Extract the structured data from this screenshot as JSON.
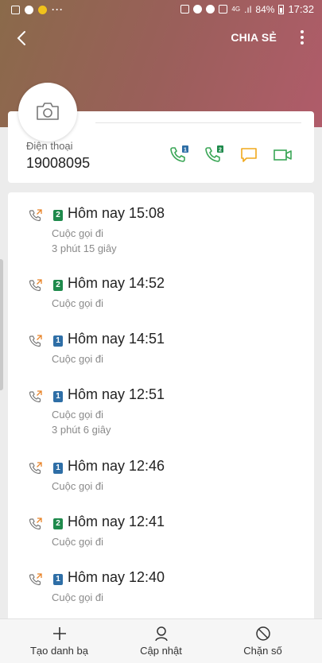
{
  "status_bar": {
    "battery": "84%",
    "time": "17:32",
    "network": "4G"
  },
  "toolbar": {
    "share_label": "CHIA SẺ"
  },
  "contact": {
    "phone_label": "Điện thoại",
    "phone_number": "19008095",
    "actions": [
      {
        "icon": "phone-sim1-icon",
        "sim": "1"
      },
      {
        "icon": "phone-sim2-icon",
        "sim": "2"
      },
      {
        "icon": "message-icon"
      },
      {
        "icon": "video-call-icon"
      }
    ]
  },
  "call_log": [
    {
      "sim": "2",
      "title": "Hôm nay 15:08",
      "type": "Cuộc gọi đi",
      "duration": "3 phút 15 giây"
    },
    {
      "sim": "2",
      "title": "Hôm nay 14:52",
      "type": "Cuộc gọi đi",
      "duration": ""
    },
    {
      "sim": "1",
      "title": "Hôm nay 14:51",
      "type": "Cuộc gọi đi",
      "duration": ""
    },
    {
      "sim": "1",
      "title": "Hôm nay 12:51",
      "type": "Cuộc gọi đi",
      "duration": "3 phút 6 giây"
    },
    {
      "sim": "1",
      "title": "Hôm nay 12:46",
      "type": "Cuộc gọi đi",
      "duration": ""
    },
    {
      "sim": "2",
      "title": "Hôm nay 12:41",
      "type": "Cuộc gọi đi",
      "duration": ""
    },
    {
      "sim": "1",
      "title": "Hôm nay 12:40",
      "type": "Cuộc gọi đi",
      "duration": ""
    }
  ],
  "bottom_bar": {
    "create_contact": "Tạo danh bạ",
    "update": "Cập nhật",
    "block": "Chặn số"
  },
  "colors": {
    "sim1": "#2e6ea6",
    "sim2": "#1f8a4c",
    "call_green": "#3aa656",
    "message_orange": "#f0a81c",
    "outgoing_arrow": "#e8842a"
  }
}
